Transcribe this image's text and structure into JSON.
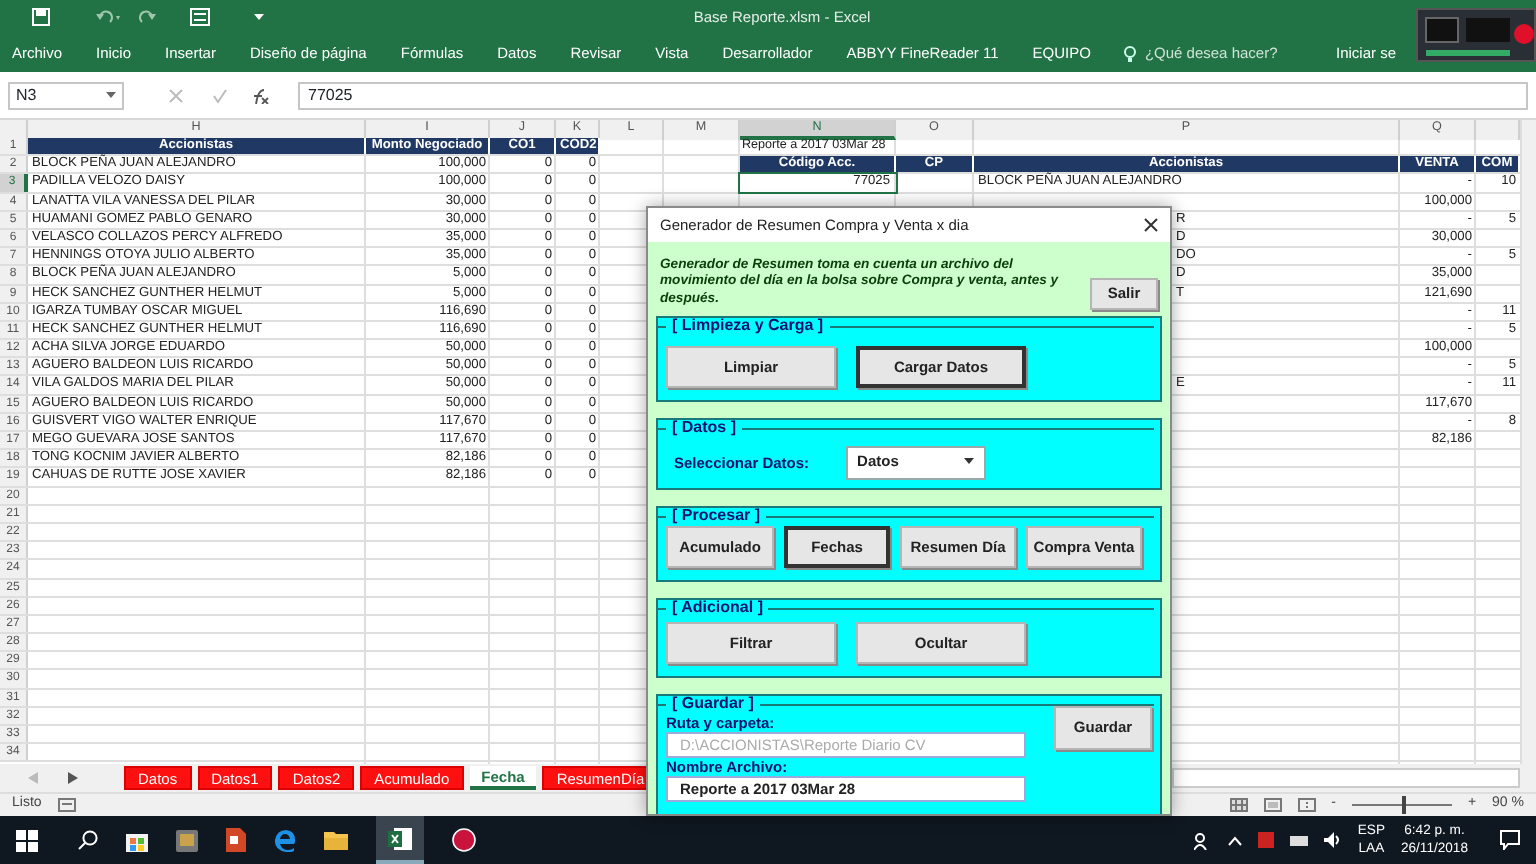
{
  "window": {
    "title": "Base Reporte.xlsm - Excel",
    "user": "Iniciar se"
  },
  "ribbon_tabs": [
    "Archivo",
    "Inicio",
    "Insertar",
    "Diseño de página",
    "Fórmulas",
    "Datos",
    "Revisar",
    "Vista",
    "Desarrollador",
    "ABBYY FineReader 11",
    "EQUIPO"
  ],
  "tell_me": "¿Qué desea hacer?",
  "formula_bar": {
    "name_box": "N3",
    "formula": "77025"
  },
  "columns": [
    {
      "label": "H",
      "selected": false
    },
    {
      "label": "I",
      "selected": false
    },
    {
      "label": "J",
      "selected": false
    },
    {
      "label": "K",
      "selected": false
    },
    {
      "label": "L",
      "selected": false
    },
    {
      "label": "M",
      "selected": false
    },
    {
      "label": "N",
      "selected": true
    },
    {
      "label": "O",
      "selected": false
    },
    {
      "label": "P",
      "selected": false
    },
    {
      "label": "Q",
      "selected": false
    }
  ],
  "row_numbers": [
    {
      "label": "1",
      "selected": false
    },
    {
      "label": "2",
      "selected": false
    },
    {
      "label": "3",
      "selected": true
    },
    {
      "label": "4",
      "selected": false
    },
    {
      "label": "5",
      "selected": false
    },
    {
      "label": "6",
      "selected": false
    },
    {
      "label": "7",
      "selected": false
    },
    {
      "label": "8",
      "selected": false
    },
    {
      "label": "9",
      "selected": false
    },
    {
      "label": "10",
      "selected": false
    },
    {
      "label": "11",
      "selected": false
    },
    {
      "label": "12",
      "selected": false
    },
    {
      "label": "13",
      "selected": false
    },
    {
      "label": "14",
      "selected": false
    },
    {
      "label": "15",
      "selected": false
    },
    {
      "label": "16",
      "selected": false
    },
    {
      "label": "17",
      "selected": false
    },
    {
      "label": "18",
      "selected": false
    },
    {
      "label": "19",
      "selected": false
    },
    {
      "label": "20",
      "selected": false
    },
    {
      "label": "21",
      "selected": false
    },
    {
      "label": "22",
      "selected": false
    },
    {
      "label": "23",
      "selected": false
    },
    {
      "label": "24",
      "selected": false
    },
    {
      "label": "25",
      "selected": false
    },
    {
      "label": "26",
      "selected": false
    },
    {
      "label": "27",
      "selected": false
    },
    {
      "label": "28",
      "selected": false
    },
    {
      "label": "29",
      "selected": false
    },
    {
      "label": "30",
      "selected": false
    },
    {
      "label": "31",
      "selected": false
    },
    {
      "label": "32",
      "selected": false
    },
    {
      "label": "33",
      "selected": false
    },
    {
      "label": "34",
      "selected": false
    }
  ],
  "left_table": {
    "columns": [
      "Accionistas",
      "Monto Negociado",
      "CO1",
      "COD2"
    ],
    "rows": [
      [
        "BLOCK PEÑA JUAN ALEJANDRO",
        "100,000",
        "0",
        "0"
      ],
      [
        "PADILLA VELOZO DAISY",
        "100,000",
        "0",
        "0"
      ],
      [
        "LANATTA VILA VANESSA DEL PILAR",
        "30,000",
        "0",
        "0"
      ],
      [
        "HUAMANI GOMEZ PABLO GENARO",
        "30,000",
        "0",
        "0"
      ],
      [
        "VELASCO COLLAZOS PERCY ALFREDO",
        "35,000",
        "0",
        "0"
      ],
      [
        "HENNINGS OTOYA JULIO ALBERTO",
        "35,000",
        "0",
        "0"
      ],
      [
        "BLOCK PEÑA JUAN ALEJANDRO",
        "5,000",
        "0",
        "0"
      ],
      [
        "HECK SANCHEZ GUNTHER HELMUT",
        "5,000",
        "0",
        "0"
      ],
      [
        "IGARZA TUMBAY OSCAR MIGUEL",
        "116,690",
        "0",
        "0"
      ],
      [
        "HECK SANCHEZ GUNTHER HELMUT",
        "116,690",
        "0",
        "0"
      ],
      [
        "ACHA SILVA JORGE EDUARDO",
        "50,000",
        "0",
        "0"
      ],
      [
        "AGUERO BALDEON LUIS RICARDO",
        "50,000",
        "0",
        "0"
      ],
      [
        "VILA GALDOS MARIA DEL PILAR",
        "50,000",
        "0",
        "0"
      ],
      [
        "AGUERO BALDEON LUIS RICARDO",
        "50,000",
        "0",
        "0"
      ],
      [
        "GUISVERT VIGO WALTER ENRIQUE",
        "117,670",
        "0",
        "0"
      ],
      [
        "MEGO GUEVARA JOSE SANTOS",
        "117,670",
        "0",
        "0"
      ],
      [
        "TONG KOCNIM JAVIER ALBERTO",
        "82,186",
        "0",
        "0"
      ],
      [
        "CAHUAS DE RUTTE JOSE XAVIER",
        "82,186",
        "0",
        "0"
      ]
    ]
  },
  "right_table": {
    "title": "Reporte a 2017 03Mar 28",
    "columns": [
      "Código Acc.",
      "CP",
      "Accionistas",
      "VENTA",
      "COM"
    ],
    "rows": [
      {
        "code": "77025",
        "accionista": "BLOCK PEÑA JUAN ALEJANDRO",
        "venta": "-",
        "com": "10"
      },
      {
        "venta": "100,000"
      },
      {
        "accionista_tail": "R",
        "venta": "-",
        "com": "5"
      },
      {
        "accionista_tail": "D",
        "venta": "30,000"
      },
      {
        "accionista_tail": "DO",
        "venta": "-",
        "com": "5"
      },
      {
        "accionista_tail": "D",
        "venta": "35,000"
      },
      {
        "accionista_tail": "T",
        "venta": "121,690"
      },
      {
        "venta": "-",
        "com": "11"
      },
      {
        "venta": "-",
        "com": "5"
      },
      {
        "venta": "100,000"
      },
      {
        "venta": "-",
        "com": "5"
      },
      {
        "accionista_tail": "E",
        "venta": "-",
        "com": "11"
      },
      {
        "venta": "117,670"
      },
      {
        "venta": "-",
        "com": "8"
      },
      {
        "venta": "82,186"
      }
    ]
  },
  "dialog": {
    "title": "Generador de Resumen Compra y Venta x dia",
    "description": "Generador de Resumen toma en cuenta un archivo del movimiento del día en la bolsa sobre Compra y venta, antes y después.",
    "exit_button": "Salir",
    "frames": [
      {
        "kind": "buttons",
        "title": "[ Limpieza y Carga ]",
        "buttons": [
          {
            "label": "Limpiar",
            "focused": false
          },
          {
            "label": "Cargar Datos",
            "focused": true
          }
        ]
      },
      {
        "kind": "select",
        "title": "[ Datos ]",
        "label": "Seleccionar Datos:",
        "value": "Datos"
      },
      {
        "kind": "buttons",
        "title": "[ Procesar ]",
        "buttons": [
          {
            "label": "Acumulado",
            "focused": false
          },
          {
            "label": "Fechas",
            "focused": true
          },
          {
            "label": "Resumen Día",
            "focused": false
          },
          {
            "label": "Compra Venta",
            "focused": false
          }
        ]
      },
      {
        "kind": "buttons",
        "title": "[ Adicional ]",
        "buttons": [
          {
            "label": "Filtrar",
            "focused": false
          },
          {
            "label": "Ocultar",
            "focused": false
          }
        ]
      },
      {
        "kind": "save",
        "title": "[ Guardar ]",
        "fields": [
          {
            "label": "Ruta y carpeta:",
            "value": "D:\\ACCIONISTAS\\Reporte Diario CV",
            "disabled": true
          },
          {
            "label": "Nombre Archivo:",
            "value": "Reporte a 2017 03Mar 28",
            "disabled": false
          }
        ],
        "button": "Guardar"
      }
    ]
  },
  "sheet_tabs": [
    {
      "label": "Datos",
      "selected": false
    },
    {
      "label": "Datos1",
      "selected": false
    },
    {
      "label": "Datos2",
      "selected": false
    },
    {
      "label": "Acumulado",
      "selected": false
    },
    {
      "label": "Fecha",
      "selected": true
    },
    {
      "label": "ResumenDía",
      "selected": false
    }
  ],
  "status_bar": {
    "status": "Listo",
    "zoom_out": "-",
    "zoom_in": "+",
    "zoom": {
      "level": 0.5,
      "reading": "90 %"
    }
  },
  "taskbar": {
    "language": "ESP",
    "keyboard": "LAA",
    "time": "6:42 p. m.",
    "date": "26/11/2018"
  }
}
